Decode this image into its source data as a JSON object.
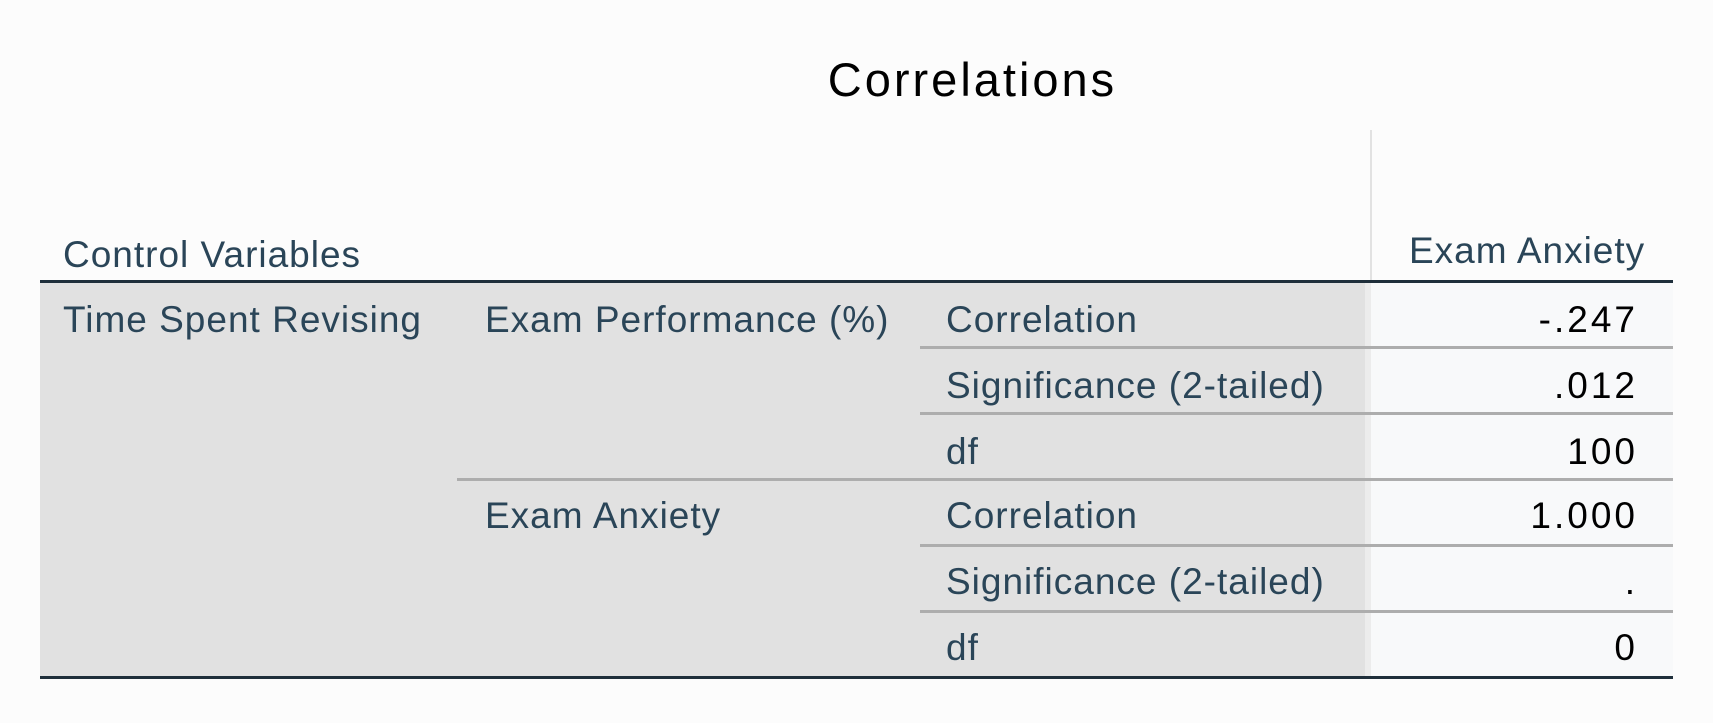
{
  "table": {
    "title": "Correlations",
    "header": {
      "control_variables": "Control Variables",
      "column": "Exam Anxiety"
    },
    "control_variable": "Time Spent Revising",
    "groups": [
      {
        "variable": "Exam Performance (%)",
        "rows": [
          {
            "stat": "Correlation",
            "value": "-.247"
          },
          {
            "stat": "Significance (2-tailed)",
            "value": ".012"
          },
          {
            "stat": "df",
            "value": "100"
          }
        ]
      },
      {
        "variable": "Exam Anxiety",
        "rows": [
          {
            "stat": "Correlation",
            "value": "1.000"
          },
          {
            "stat": "Significance (2-tailed)",
            "value": "."
          },
          {
            "stat": "df",
            "value": "0"
          }
        ]
      }
    ]
  }
}
